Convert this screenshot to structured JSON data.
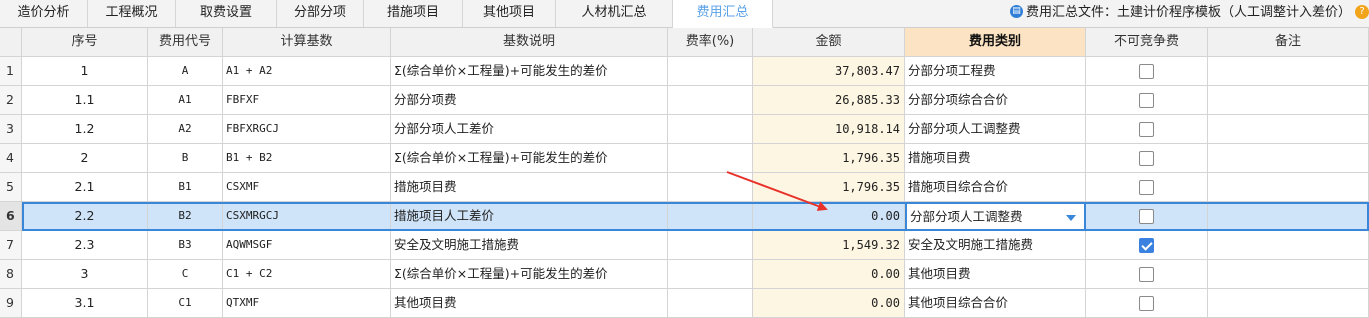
{
  "tabs": [
    {
      "label": "造价分析",
      "active": false
    },
    {
      "label": "工程概况",
      "active": false
    },
    {
      "label": "取费设置",
      "active": false
    },
    {
      "label": "分部分项",
      "active": false
    },
    {
      "label": "措施项目",
      "active": false
    },
    {
      "label": "其他项目",
      "active": false
    },
    {
      "label": "人材机汇总",
      "active": false
    },
    {
      "label": "费用汇总",
      "active": true
    }
  ],
  "file_info": "费用汇总文件：土建计价程序模板（人工调整计入差价）",
  "info_icon": "document-info-icon",
  "help_icon": "help-icon",
  "columns": [
    "序号",
    "费用代号",
    "计算基数",
    "基数说明",
    "费率(%)",
    "金额",
    "费用类别",
    "不可竞争费",
    "备注"
  ],
  "rows": [
    {
      "idx": "1",
      "seq": "1",
      "code": "A",
      "base": "A1 + A2",
      "desc": "Σ(综合单价×工程量)+可能发生的差价",
      "rate": "",
      "amount": "37,803.47",
      "category": "分部分项工程费",
      "noncompete": false,
      "note": ""
    },
    {
      "idx": "2",
      "seq": "1.1",
      "code": "A1",
      "base": "FBFXF",
      "desc": "分部分项费",
      "rate": "",
      "amount": "26,885.33",
      "category": "分部分项综合合价",
      "noncompete": false,
      "note": ""
    },
    {
      "idx": "3",
      "seq": "1.2",
      "code": "A2",
      "base": "FBFXRGCJ",
      "desc": "分部分项人工差价",
      "rate": "",
      "amount": "10,918.14",
      "category": "分部分项人工调整费",
      "noncompete": false,
      "note": ""
    },
    {
      "idx": "4",
      "seq": "2",
      "code": "B",
      "base": "B1 + B2",
      "desc": "Σ(综合单价×工程量)+可能发生的差价",
      "rate": "",
      "amount": "1,796.35",
      "category": "措施项目费",
      "noncompete": false,
      "note": ""
    },
    {
      "idx": "5",
      "seq": "2.1",
      "code": "B1",
      "base": "CSXMF",
      "desc": "措施项目费",
      "rate": "",
      "amount": "1,796.35",
      "category": "措施项目综合合价",
      "noncompete": false,
      "note": ""
    },
    {
      "idx": "6",
      "seq": "2.2",
      "code": "B2",
      "base": "CSXMRGCJ",
      "desc": "措施项目人工差价",
      "rate": "",
      "amount": "0.00",
      "category": "分部分项人工调整费",
      "noncompete": false,
      "note": "",
      "selected": true
    },
    {
      "idx": "7",
      "seq": "2.3",
      "code": "B3",
      "base": "AQWMSGF",
      "desc": "安全及文明施工措施费",
      "rate": "",
      "amount": "1,549.32",
      "category": "安全及文明施工措施费",
      "noncompete": true,
      "note": ""
    },
    {
      "idx": "8",
      "seq": "3",
      "code": "C",
      "base": "C1 + C2",
      "desc": "Σ(综合单价×工程量)+可能发生的差价",
      "rate": "",
      "amount": "0.00",
      "category": "其他项目费",
      "noncompete": false,
      "note": ""
    },
    {
      "idx": "9",
      "seq": "3.1",
      "code": "C1",
      "base": "QTXMF",
      "desc": "其他项目费",
      "rate": "",
      "amount": "0.00",
      "category": "其他项目综合合价",
      "noncompete": false,
      "note": ""
    }
  ],
  "annotation_arrow_color": "#e8322a",
  "selection_color": "#3a86d8"
}
